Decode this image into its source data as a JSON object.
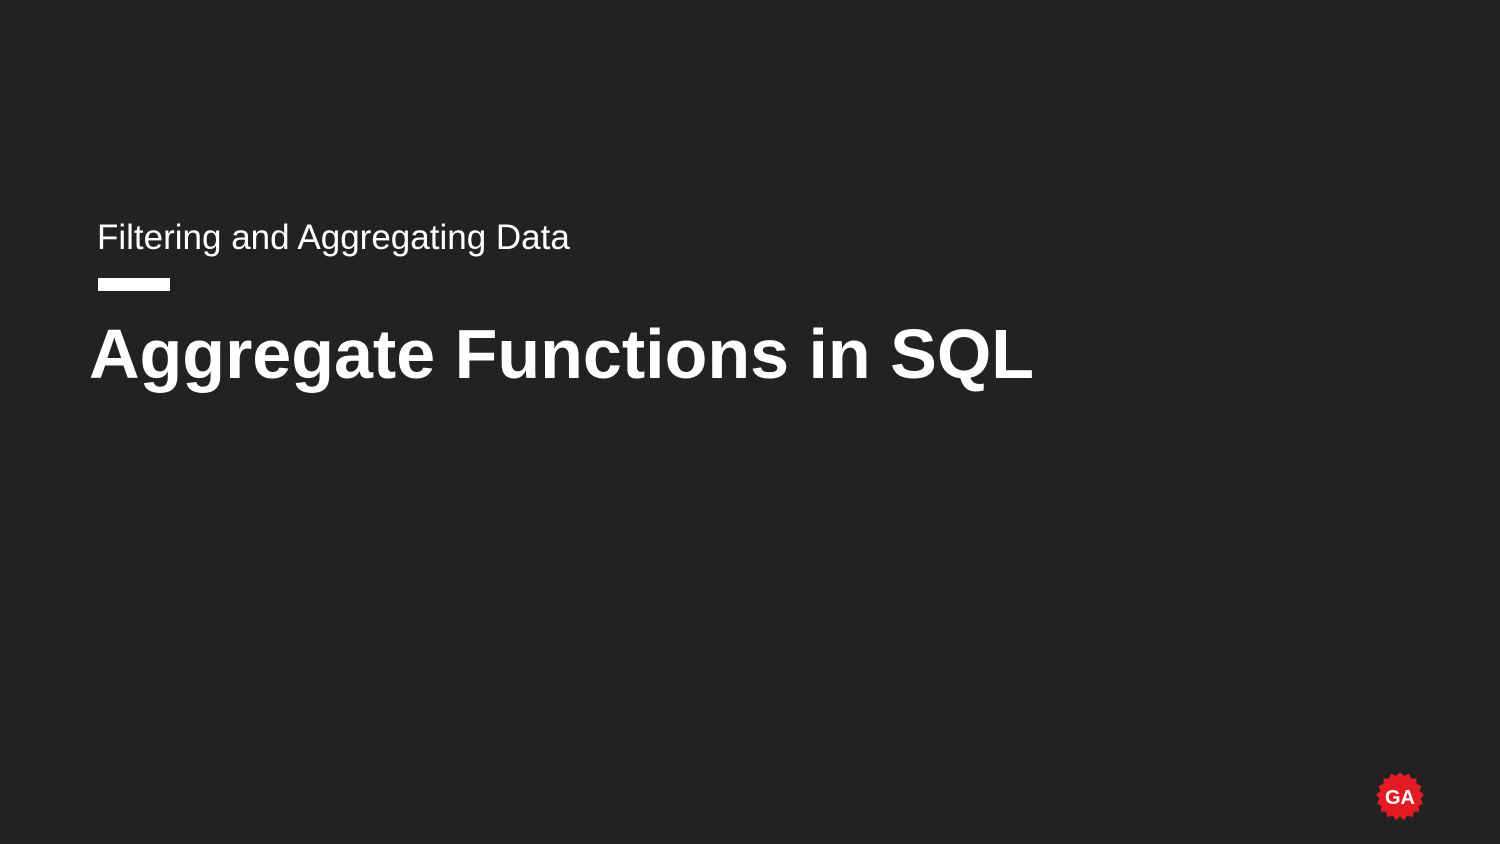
{
  "slide": {
    "subtitle": "Filtering and Aggregating Data",
    "title": "Aggregate Functions in SQL"
  },
  "logo": {
    "icon": "ga-logo-icon",
    "text": "GA",
    "color": "#e31b23"
  },
  "colors": {
    "background": "#222222",
    "text": "#ffffff",
    "accent_rule": "#ffffff"
  }
}
